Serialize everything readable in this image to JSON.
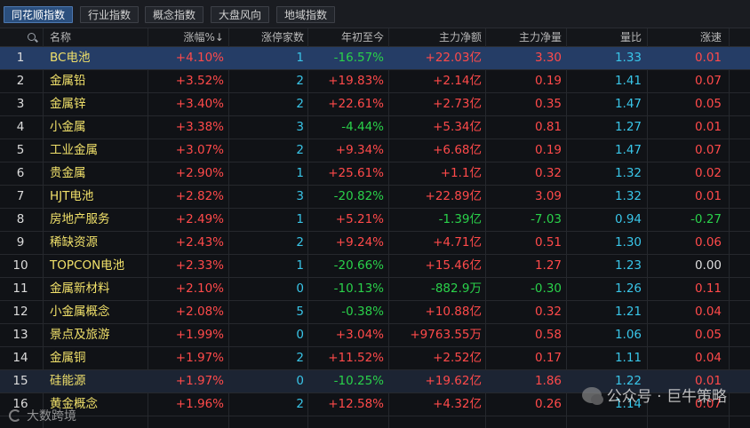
{
  "tabs": [
    {
      "label": "同花顺指数",
      "active": true
    },
    {
      "label": "行业指数",
      "active": false
    },
    {
      "label": "概念指数",
      "active": false
    },
    {
      "label": "大盘风向",
      "active": false
    },
    {
      "label": "地域指数",
      "active": false
    }
  ],
  "columns": {
    "name": "名称",
    "change_pct": "涨幅%↓",
    "limit_up": "涨停家数",
    "ytd": "年初至今",
    "main_net": "主力净额",
    "main_strength": "主力净量",
    "volume_ratio": "量比",
    "speed": "涨速"
  },
  "rows": [
    {
      "idx": "1",
      "name": "BC电池",
      "chg": "+4.10%",
      "cnt": "1",
      "ytd": "-16.57%",
      "net": "+22.03亿",
      "sty": "3.30",
      "vol": "1.33",
      "spd": "0.01"
    },
    {
      "idx": "2",
      "name": "金属铅",
      "chg": "+3.52%",
      "cnt": "2",
      "ytd": "+19.83%",
      "net": "+2.14亿",
      "sty": "0.19",
      "vol": "1.41",
      "spd": "0.07"
    },
    {
      "idx": "3",
      "name": "金属锌",
      "chg": "+3.40%",
      "cnt": "2",
      "ytd": "+22.61%",
      "net": "+2.73亿",
      "sty": "0.35",
      "vol": "1.47",
      "spd": "0.05"
    },
    {
      "idx": "4",
      "name": "小金属",
      "chg": "+3.38%",
      "cnt": "3",
      "ytd": "-4.44%",
      "net": "+5.34亿",
      "sty": "0.81",
      "vol": "1.27",
      "spd": "0.01"
    },
    {
      "idx": "5",
      "name": "工业金属",
      "chg": "+3.07%",
      "cnt": "2",
      "ytd": "+9.34%",
      "net": "+6.68亿",
      "sty": "0.19",
      "vol": "1.47",
      "spd": "0.07"
    },
    {
      "idx": "6",
      "name": "贵金属",
      "chg": "+2.90%",
      "cnt": "1",
      "ytd": "+25.61%",
      "net": "+1.1亿",
      "sty": "0.32",
      "vol": "1.32",
      "spd": "0.02"
    },
    {
      "idx": "7",
      "name": "HJT电池",
      "chg": "+2.82%",
      "cnt": "3",
      "ytd": "-20.82%",
      "net": "+22.89亿",
      "sty": "3.09",
      "vol": "1.32",
      "spd": "0.01"
    },
    {
      "idx": "8",
      "name": "房地产服务",
      "chg": "+2.49%",
      "cnt": "1",
      "ytd": "+5.21%",
      "net": "-1.39亿",
      "sty": "-7.03",
      "vol": "0.94",
      "spd": "-0.27"
    },
    {
      "idx": "9",
      "name": "稀缺资源",
      "chg": "+2.43%",
      "cnt": "2",
      "ytd": "+9.24%",
      "net": "+4.71亿",
      "sty": "0.51",
      "vol": "1.30",
      "spd": "0.06"
    },
    {
      "idx": "10",
      "name": "TOPCON电池",
      "chg": "+2.33%",
      "cnt": "1",
      "ytd": "-20.66%",
      "net": "+15.46亿",
      "sty": "1.27",
      "vol": "1.23",
      "spd": "0.00"
    },
    {
      "idx": "11",
      "name": "金属新材料",
      "chg": "+2.10%",
      "cnt": "0",
      "ytd": "-10.13%",
      "net": "-882.9万",
      "sty": "-0.30",
      "vol": "1.26",
      "spd": "0.11"
    },
    {
      "idx": "12",
      "name": "小金属概念",
      "chg": "+2.08%",
      "cnt": "5",
      "ytd": "-0.38%",
      "net": "+10.88亿",
      "sty": "0.32",
      "vol": "1.21",
      "spd": "0.04"
    },
    {
      "idx": "13",
      "name": "景点及旅游",
      "chg": "+1.99%",
      "cnt": "0",
      "ytd": "+3.04%",
      "net": "+9763.55万",
      "sty": "0.58",
      "vol": "1.06",
      "spd": "0.05"
    },
    {
      "idx": "14",
      "name": "金属铜",
      "chg": "+1.97%",
      "cnt": "2",
      "ytd": "+11.52%",
      "net": "+2.52亿",
      "sty": "0.17",
      "vol": "1.11",
      "spd": "0.04"
    },
    {
      "idx": "15",
      "name": "硅能源",
      "chg": "+1.97%",
      "cnt": "0",
      "ytd": "-10.25%",
      "net": "+19.62亿",
      "sty": "1.86",
      "vol": "1.22",
      "spd": "0.01"
    },
    {
      "idx": "16",
      "name": "黄金概念",
      "chg": "+1.96%",
      "cnt": "2",
      "ytd": "+12.58%",
      "net": "+4.32亿",
      "sty": "0.26",
      "vol": "1.14",
      "spd": "0.07"
    }
  ],
  "watermark": {
    "text": "公众号 · 巨牛策略"
  },
  "watermark2": {
    "text": "大数跨境"
  },
  "colors": {
    "up": "#ff4a4a",
    "down": "#2ad14a",
    "name": "#f0e06a",
    "cyan": "#39c5e8",
    "selected": "#253d66"
  }
}
